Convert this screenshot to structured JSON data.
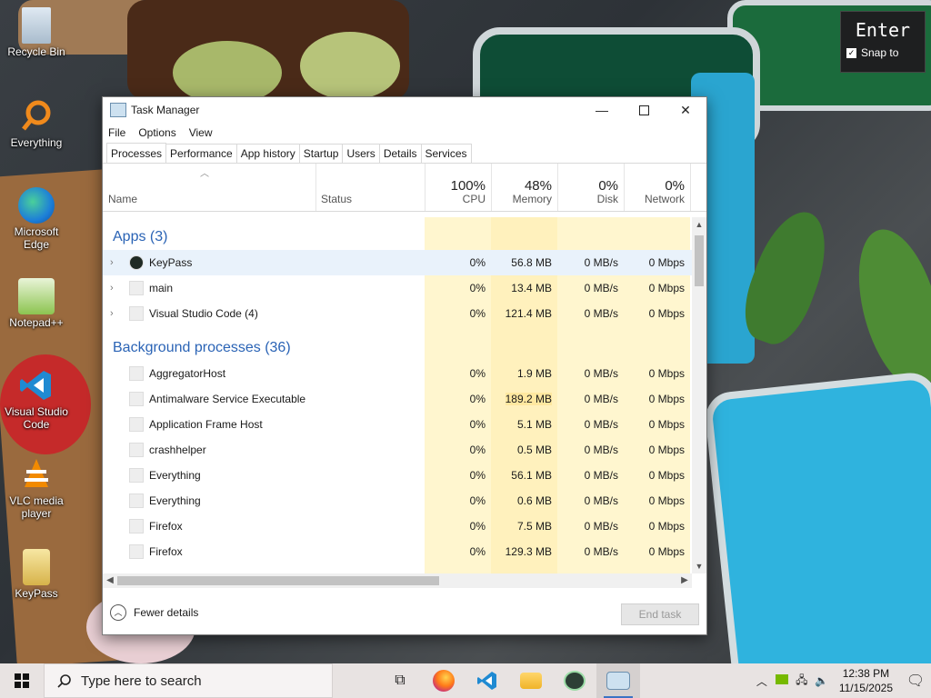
{
  "desktop": {
    "icons": [
      {
        "label": "Recycle Bin",
        "icon": "recycle-bin-icon"
      },
      {
        "label": "Everything",
        "icon": "everything-search-icon"
      },
      {
        "label": "Microsoft Edge",
        "icon": "edge-icon"
      },
      {
        "label": "Notepad++",
        "icon": "notepad-plus-plus-icon"
      },
      {
        "label": "Visual Studio Code",
        "icon": "vscode-icon"
      },
      {
        "label": "VLC media player",
        "icon": "vlc-icon"
      },
      {
        "label": "KeyPass",
        "icon": "keypass-icon"
      }
    ]
  },
  "overlay": {
    "key": "Enter",
    "snap_label": "Snap to",
    "snap_checked": true
  },
  "window": {
    "title": "Task Manager",
    "menu": [
      "File",
      "Options",
      "View"
    ],
    "tabs": [
      "Processes",
      "Performance",
      "App history",
      "Startup",
      "Users",
      "Details",
      "Services"
    ],
    "active_tab": "Processes",
    "columns": {
      "name": "Name",
      "status": "Status",
      "cpu": {
        "label": "CPU",
        "total": "100%"
      },
      "memory": {
        "label": "Memory",
        "total": "48%"
      },
      "disk": {
        "label": "Disk",
        "total": "0%"
      },
      "network": {
        "label": "Network",
        "total": "0%"
      }
    },
    "groups": [
      {
        "label": "Apps (3)",
        "rows": [
          {
            "name": "KeyPass",
            "cpu": "0%",
            "memory": "56.8 MB",
            "disk": "0 MB/s",
            "network": "0 Mbps",
            "expandable": true,
            "highlight": true
          },
          {
            "name": "main",
            "cpu": "0%",
            "memory": "13.4 MB",
            "disk": "0 MB/s",
            "network": "0 Mbps",
            "expandable": true
          },
          {
            "name": "Visual Studio Code (4)",
            "cpu": "0%",
            "memory": "121.4 MB",
            "disk": "0 MB/s",
            "network": "0 Mbps",
            "expandable": true
          }
        ]
      },
      {
        "label": "Background processes (36)",
        "rows": [
          {
            "name": "AggregatorHost",
            "cpu": "0%",
            "memory": "1.9 MB",
            "disk": "0 MB/s",
            "network": "0 Mbps"
          },
          {
            "name": "Antimalware Service Executable",
            "cpu": "0%",
            "memory": "189.2 MB",
            "disk": "0 MB/s",
            "network": "0 Mbps"
          },
          {
            "name": "Application Frame Host",
            "cpu": "0%",
            "memory": "5.1 MB",
            "disk": "0 MB/s",
            "network": "0 Mbps"
          },
          {
            "name": "crashhelper",
            "cpu": "0%",
            "memory": "0.5 MB",
            "disk": "0 MB/s",
            "network": "0 Mbps"
          },
          {
            "name": "Everything",
            "cpu": "0%",
            "memory": "56.1 MB",
            "disk": "0 MB/s",
            "network": "0 Mbps"
          },
          {
            "name": "Everything",
            "cpu": "0%",
            "memory": "0.6 MB",
            "disk": "0 MB/s",
            "network": "0 Mbps"
          },
          {
            "name": "Firefox",
            "cpu": "0%",
            "memory": "7.5 MB",
            "disk": "0 MB/s",
            "network": "0 Mbps"
          },
          {
            "name": "Firefox",
            "cpu": "0%",
            "memory": "129.3 MB",
            "disk": "0 MB/s",
            "network": "0 Mbps"
          }
        ]
      }
    ],
    "footer": {
      "fewer_details": "Fewer details",
      "end_task": "End task"
    },
    "colors": {
      "cpu_bg": "#fff4c4",
      "mem_bg": "#fff1bd",
      "mem_hot": "#ffe8a0",
      "group": "#2a63b5"
    }
  },
  "taskbar": {
    "search_placeholder": "Type here to search",
    "apps": [
      "task-view-icon",
      "firefox-icon",
      "vscode-icon",
      "file-explorer-icon",
      "keypass-icon",
      "task-manager-icon"
    ],
    "time": "12:38 PM",
    "date": "11/15/2025"
  }
}
